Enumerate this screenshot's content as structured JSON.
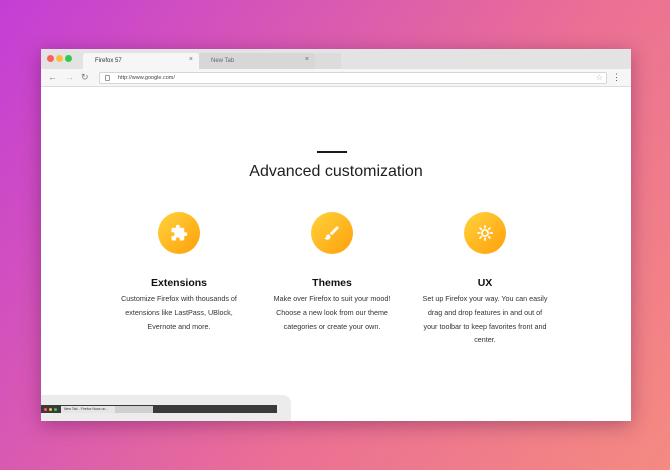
{
  "browser": {
    "tabs": [
      {
        "label": "Firefox 57",
        "active": true
      },
      {
        "label": "New Tab",
        "active": false
      }
    ],
    "close_glyph": "×",
    "url": "http://www.google.com/",
    "nav": {
      "back": "←",
      "forward": "→",
      "reload": "↻",
      "bookmark": "☆",
      "menu": "⋮"
    }
  },
  "page": {
    "heading": "Advanced customization",
    "features": [
      {
        "title": "Extensions",
        "description": "Customize Firefox with thousands of extensions like LastPass, UBlock, Evernote and more.",
        "icon": "puzzle-icon"
      },
      {
        "title": "Themes",
        "description": "Make over Firefox to suit your mood! Choose a new look from our theme categories or create your own.",
        "icon": "paintbrush-icon"
      },
      {
        "title": "UX",
        "description": "Set up Firefox your way. You can easily drag and drop features in and out of your toolbar to keep favorites front and center.",
        "icon": "gear-icon"
      }
    ],
    "thumbnail_tab_label": "New Tab - Firefox Nova on..."
  },
  "colors": {
    "accent_start": "#ffd33d",
    "accent_end": "#ff9f0a",
    "background_start": "#c43ed6",
    "background_end": "#f58a80"
  }
}
